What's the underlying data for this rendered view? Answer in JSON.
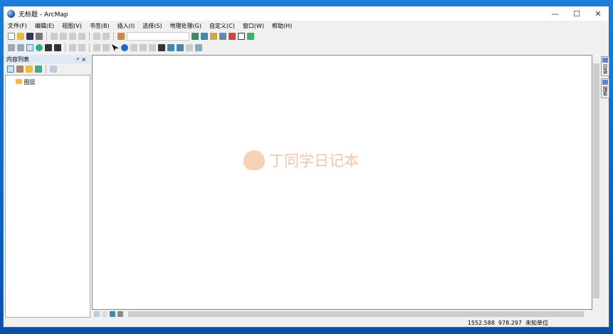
{
  "window": {
    "title": "无标题 - ArcMap",
    "controls": [
      "—",
      "☐",
      "✕"
    ]
  },
  "menu": [
    "文件(F)",
    "编辑(E)",
    "视图(V)",
    "书签(B)",
    "插入(I)",
    "选择(S)",
    "地理处理(G)",
    "自定义(C)",
    "窗口(W)",
    "帮助(H)"
  ],
  "toc": {
    "title": "内容列表",
    "pin": "ᵖ",
    "close": "×",
    "root": "图层"
  },
  "side_tabs": [
    "目录",
    "搜索"
  ],
  "status": {
    "x": "1552.588",
    "y": "978.297",
    "units": "未知单位"
  },
  "watermark": "丁同学日记本",
  "colors": {
    "accent": "#0b5fbf"
  }
}
